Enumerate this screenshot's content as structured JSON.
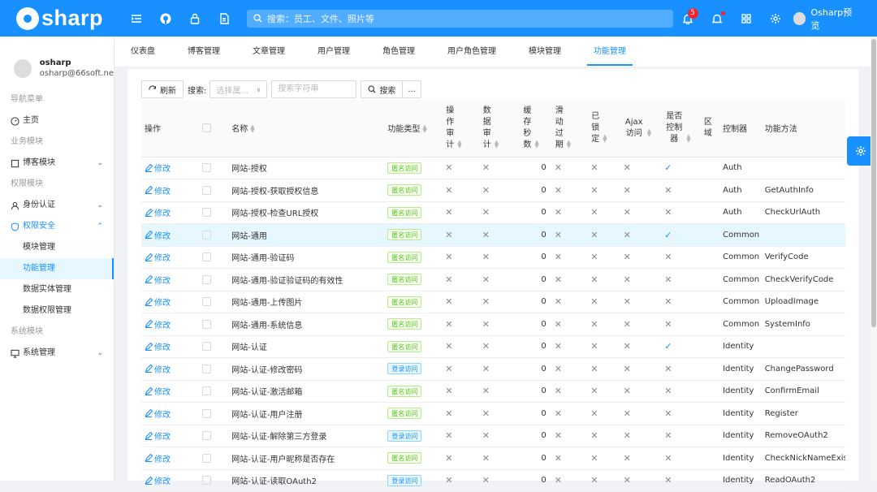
{
  "app": {
    "logo_text": "sharp"
  },
  "topbar": {
    "search_placeholder": "搜索：员工、文件、照片等",
    "notification_count": "5",
    "user_name": "Osharp预览"
  },
  "profile": {
    "name": "osharp",
    "email": "osharp@66soft.ne"
  },
  "menu": {
    "nav_group": "导航菜单",
    "home": "主页",
    "biz_group": "业务模块",
    "blog_module": "博客模块",
    "perm_group": "权限模块",
    "identity": "身份认证",
    "security": "权限安全",
    "security_sub": [
      "模块管理",
      "功能管理",
      "数据实体管理",
      "数据权限管理"
    ],
    "sys_group": "系统模块",
    "sys_manage": "系统管理"
  },
  "tabs": [
    "仪表盘",
    "博客管理",
    "文章管理",
    "用户管理",
    "角色管理",
    "用户角色管理",
    "模块管理",
    "功能管理"
  ],
  "toolbar": {
    "refresh": "刷新",
    "search_label": "搜索:",
    "select_placeholder": "选择属...",
    "input_placeholder": "搜索字符串",
    "search_btn": "搜索",
    "more": "..."
  },
  "columns": {
    "op": "操作",
    "name": "名称",
    "type": "功能类型",
    "audit_op": "操作审计",
    "audit_data": "数据审计",
    "cache": "缓存秒数",
    "sliding": "滑动过期",
    "locked": "已锁定",
    "ajax": "Ajax访问",
    "is_ctrl": "是否控制器",
    "area": "区域",
    "controller": "控制器",
    "action": "功能方法"
  },
  "edit_label": "修改",
  "rows": [
    {
      "name": "网站-授权",
      "type": "匿名访问",
      "type_kind": "anon",
      "cache": "0",
      "is_ctrl": true,
      "controller": "Auth",
      "action": "",
      "hl": false
    },
    {
      "name": "网站-授权-获取授权信息",
      "type": "匿名访问",
      "type_kind": "anon",
      "cache": "0",
      "is_ctrl": false,
      "controller": "Auth",
      "action": "GetAuthInfo",
      "hl": false
    },
    {
      "name": "网站-授权-检查URL授权",
      "type": "匿名访问",
      "type_kind": "anon",
      "cache": "0",
      "is_ctrl": false,
      "controller": "Auth",
      "action": "CheckUrlAuth",
      "hl": false
    },
    {
      "name": "网站-通用",
      "type": "匿名访问",
      "type_kind": "anon",
      "cache": "0",
      "is_ctrl": true,
      "controller": "Common",
      "action": "",
      "hl": true
    },
    {
      "name": "网站-通用-验证码",
      "type": "匿名访问",
      "type_kind": "anon",
      "cache": "0",
      "is_ctrl": false,
      "controller": "Common",
      "action": "VerifyCode",
      "hl": false
    },
    {
      "name": "网站-通用-验证验证码的有效性",
      "type": "匿名访问",
      "type_kind": "anon",
      "cache": "0",
      "is_ctrl": false,
      "controller": "Common",
      "action": "CheckVerifyCode",
      "hl": false
    },
    {
      "name": "网站-通用-上传图片",
      "type": "匿名访问",
      "type_kind": "anon",
      "cache": "0",
      "is_ctrl": false,
      "controller": "Common",
      "action": "UploadImage",
      "hl": false
    },
    {
      "name": "网站-通用-系统信息",
      "type": "匿名访问",
      "type_kind": "anon",
      "cache": "0",
      "is_ctrl": false,
      "controller": "Common",
      "action": "SystemInfo",
      "hl": false
    },
    {
      "name": "网站-认证",
      "type": "匿名访问",
      "type_kind": "anon",
      "cache": "0",
      "is_ctrl": true,
      "controller": "Identity",
      "action": "",
      "hl": false
    },
    {
      "name": "网站-认证-修改密码",
      "type": "登录访问",
      "type_kind": "login",
      "cache": "0",
      "is_ctrl": false,
      "controller": "Identity",
      "action": "ChangePassword",
      "hl": false
    },
    {
      "name": "网站-认证-激活邮箱",
      "type": "匿名访问",
      "type_kind": "anon",
      "cache": "0",
      "is_ctrl": false,
      "controller": "Identity",
      "action": "ConfirmEmail",
      "hl": false
    },
    {
      "name": "网站-认证-用户注册",
      "type": "匿名访问",
      "type_kind": "anon",
      "cache": "0",
      "is_ctrl": false,
      "controller": "Identity",
      "action": "Register",
      "hl": false
    },
    {
      "name": "网站-认证-解除第三方登录",
      "type": "登录访问",
      "type_kind": "login",
      "cache": "0",
      "is_ctrl": false,
      "controller": "Identity",
      "action": "RemoveOAuth2",
      "hl": false
    },
    {
      "name": "网站-认证-用户昵称是否存在",
      "type": "匿名访问",
      "type_kind": "anon",
      "cache": "0",
      "is_ctrl": false,
      "controller": "Identity",
      "action": "CheckNickNameExists",
      "hl": false
    },
    {
      "name": "网站-认证-读取OAuth2",
      "type": "登录访问",
      "type_kind": "login",
      "cache": "0",
      "is_ctrl": false,
      "controller": "Identity",
      "action": "ReadOAuth2",
      "hl": false
    }
  ]
}
